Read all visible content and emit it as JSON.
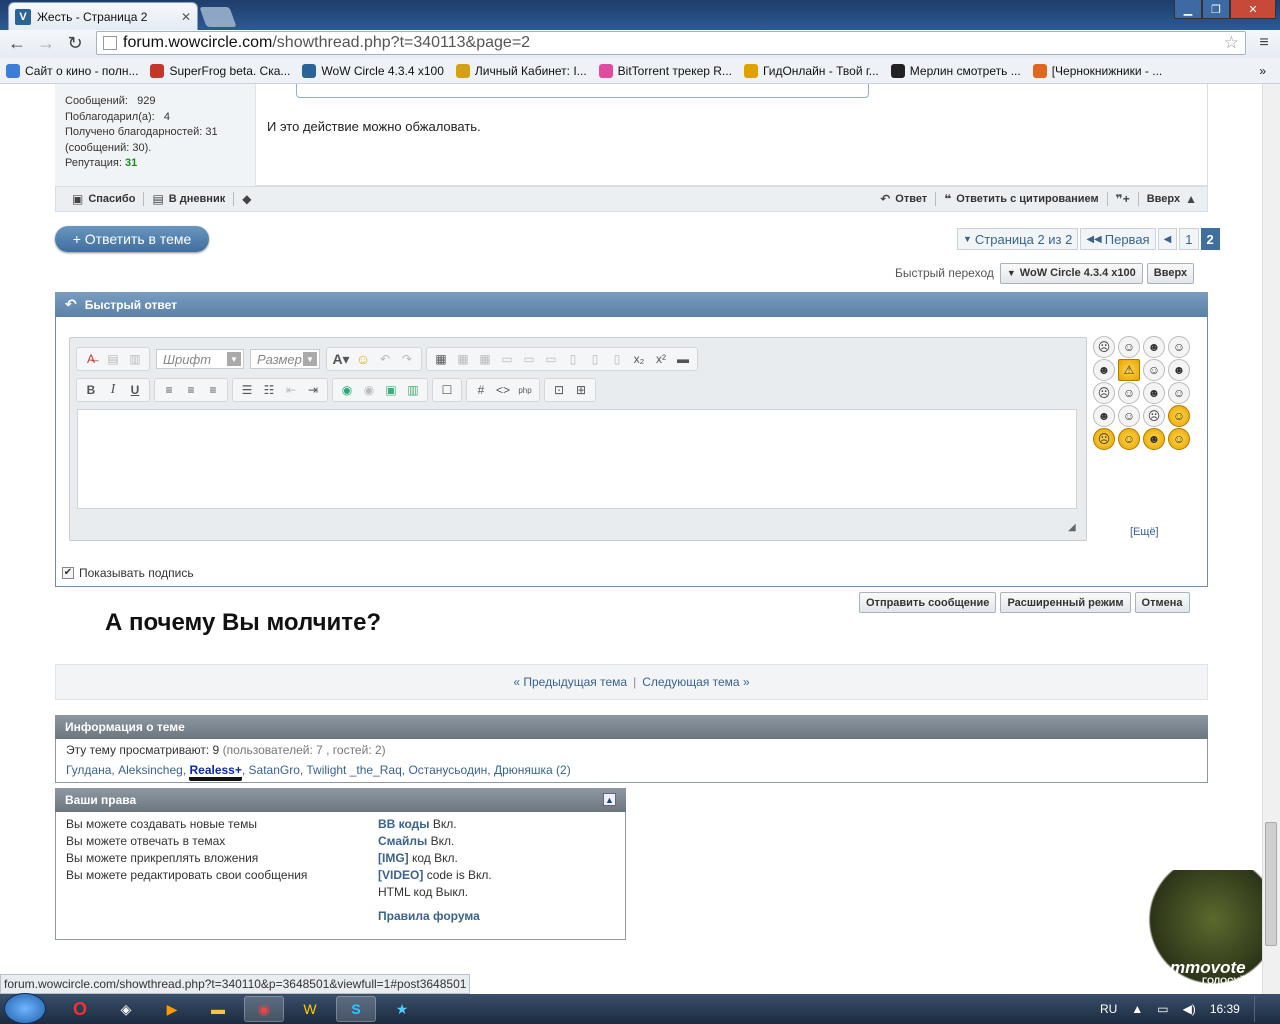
{
  "browser": {
    "tab_title": "Жесть - Страница 2",
    "tab_close": "✕",
    "url_host": "forum.wowcircle.com",
    "url_path": "/showthread.php?t=340113&page=2",
    "bookmarks": [
      {
        "label": "Сайт о кино - полн...",
        "color": "#3b7dd8"
      },
      {
        "label": "SuperFrog beta. Ска...",
        "color": "#c0392b"
      },
      {
        "label": "WoW Circle 4.3.4 x100",
        "color": "#2a6497"
      },
      {
        "label": "Личный Кабинет: I...",
        "color": "#d4a017"
      },
      {
        "label": "BitTorrent трекер R...",
        "color": "#e04b9b"
      },
      {
        "label": "ГидОнлайн - Твой г...",
        "color": "#e0a000"
      },
      {
        "label": "Мерлин смотреть ...",
        "color": "#222"
      },
      {
        "label": "[Чернокнижники - ...",
        "color": "#e0671f"
      }
    ],
    "bookmarks_overflow": "»"
  },
  "user": {
    "partial_top": "",
    "messages_label": "Сообщений:",
    "messages": "929",
    "thanked_label": "Поблагодарил(а):",
    "thanked": "4",
    "received_label": "Получено благодарностей: 31",
    "received_sub": "(сообщений: 30).",
    "rep_label": "Репутация:",
    "rep": "31"
  },
  "post": {
    "text": "И это действие можно обжаловать."
  },
  "postbar": {
    "thanks": "Спасибо",
    "diary": "В дневник",
    "reply": "Ответ",
    "reply_quote": "Ответить с цитированием",
    "top": "Вверх"
  },
  "reply_button": "+ Ответить в теме",
  "pagenav": {
    "page_of": "Страница 2 из 2",
    "first": "Первая",
    "p1": "1",
    "p2": "2"
  },
  "quickjump": {
    "label": "Быстрый переход",
    "forum": "WoW Circle 4.3.4 x100",
    "top": "Вверх"
  },
  "quick_reply": {
    "title": "Быстрый ответ",
    "font_placeholder": "Шрифт",
    "size_placeholder": "Размер",
    "more": "[Ещё]",
    "show_signature": "Показывать подпись",
    "submit": "Отправить сообщение",
    "advanced": "Расширенный режим",
    "cancel": "Отмена"
  },
  "big_question": "А почему Вы молчите?",
  "thread_nav": {
    "prev": "« Предыдущая тема",
    "sep": "|",
    "next": "Следующая тема »"
  },
  "thread_info": {
    "title": "Информация о теме",
    "viewers_label": "Эту тему просматривают:",
    "viewers_count": "9",
    "viewers_detail": "(пользователей: 7 , гостей: 2)",
    "names": [
      "Гулдана",
      "Aleksincheg",
      "Realess+",
      "SatanGro",
      "Twilight _the_Raq",
      "Останусьодин",
      "Дрюняшка (2)"
    ]
  },
  "rights": {
    "title": "Ваши права",
    "left": [
      "Вы можете создавать новые темы",
      "Вы можете отвечать в темах",
      "Вы можете прикреплять вложения",
      "Вы можете редактировать свои сообщения"
    ],
    "right": [
      {
        "key": "BB коды",
        "val": "Вкл."
      },
      {
        "key": "Смайлы",
        "val": "Вкл."
      },
      {
        "key": "[IMG]",
        "val": "код Вкл."
      },
      {
        "key": "[VIDEO]",
        "val": "code is Вкл."
      },
      {
        "key": "",
        "val": "HTML код Выкл."
      }
    ],
    "rules": "Правила форума"
  },
  "status_url": "forum.wowcircle.com/showthread.php?t=340110&p=3648501&viewfull=1#post3648501",
  "mmovote": {
    "t1": "mmovote",
    "t2": "ГОЛОСУЙ"
  },
  "taskbar": {
    "lang": "RU",
    "time": "16:39"
  },
  "colors": {
    "accent": "#3f6f9f",
    "link": "#3a6390",
    "rep": "#1e8b1e"
  }
}
